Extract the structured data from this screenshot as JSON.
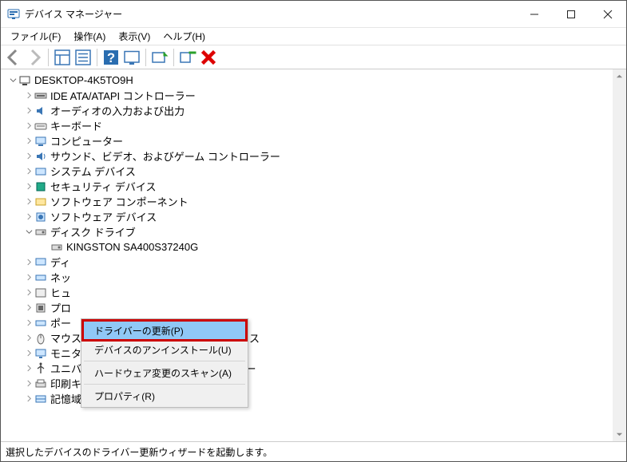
{
  "window": {
    "title": "デバイス マネージャー"
  },
  "menubar": {
    "file": "ファイル(F)",
    "action": "操作(A)",
    "view": "表示(V)",
    "help": "ヘルプ(H)"
  },
  "tree": {
    "root": "DESKTOP-4K5TO9H",
    "categories": [
      "IDE ATA/ATAPI コントローラー",
      "オーディオの入力および出力",
      "キーボード",
      "コンピューター",
      "サウンド、ビデオ、およびゲーム コントローラー",
      "システム デバイス",
      "セキュリティ デバイス",
      "ソフトウェア コンポーネント",
      "ソフトウェア デバイス"
    ],
    "disk_drives_label": "ディスク ドライブ",
    "disk_drive_item": "KINGSTON SA400S37240G",
    "below": [
      "ディ",
      "ネッ",
      "ヒュ",
      "プロ",
      "ポー",
      "マウスとそのほかのポインティング デバイス",
      "モニター",
      "ユニバーサル シリアル バス コントローラー",
      "印刷キュー",
      "記憶域コントローラー"
    ]
  },
  "context_menu": {
    "update_driver": "ドライバーの更新(P)",
    "uninstall": "デバイスのアンインストール(U)",
    "scan_hw": "ハードウェア変更のスキャン(A)",
    "properties": "プロパティ(R)"
  },
  "statusbar": "選択したデバイスのドライバー更新ウィザードを起動します。"
}
